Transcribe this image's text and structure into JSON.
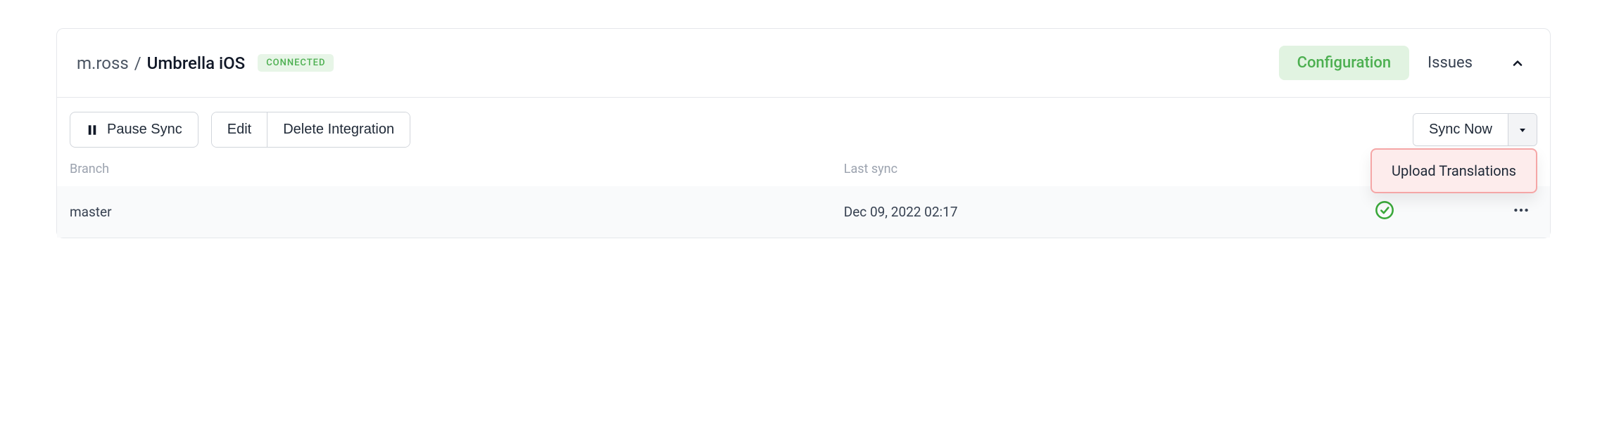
{
  "header": {
    "owner": "m.ross",
    "separator": "/",
    "project": "Umbrella iOS",
    "status_badge": "CONNECTED",
    "tabs": {
      "configuration": "Configuration",
      "issues": "Issues"
    }
  },
  "toolbar": {
    "pause_sync": "Pause Sync",
    "edit": "Edit",
    "delete_integration": "Delete Integration",
    "sync_now": "Sync Now",
    "dropdown": {
      "upload_translations": "Upload Translations"
    }
  },
  "table": {
    "headers": {
      "branch": "Branch",
      "last_sync": "Last sync"
    },
    "rows": [
      {
        "branch": "master",
        "last_sync": "Dec 09, 2022 02:17"
      }
    ]
  },
  "colors": {
    "accent_green": "#4caf50",
    "badge_bg": "#e7f5e7",
    "highlight_border": "#f5a6a6",
    "highlight_bg": "#fdecec"
  }
}
